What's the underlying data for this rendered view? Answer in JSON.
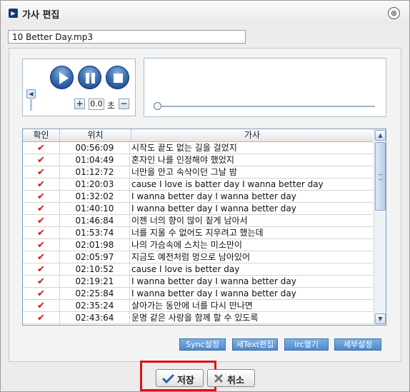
{
  "window": {
    "title": "가사 편집",
    "close_glyph": "⊗"
  },
  "file": {
    "name": "10 Better Day.mp3"
  },
  "player": {
    "offset_value": "0.0",
    "offset_unit": "초",
    "plus_glyph": "+",
    "minus_glyph": "−",
    "seek_position": 0.0
  },
  "table": {
    "headers": [
      "확인",
      "위치",
      "가사"
    ],
    "rows": [
      {
        "checked": true,
        "time": "00:56:09",
        "lyric": "시작도 끝도 없는 길을 걸었지"
      },
      {
        "checked": true,
        "time": "01:04:49",
        "lyric": "혼자인 나를 인정해야 했었지"
      },
      {
        "checked": true,
        "time": "01:12:72",
        "lyric": "너만을 안고 속삭이던 그날 밤"
      },
      {
        "checked": true,
        "time": "01:20:03",
        "lyric": "cause I love is batter day I wanna better day"
      },
      {
        "checked": true,
        "time": "01:32:02",
        "lyric": "I wanna better day I wanna better day"
      },
      {
        "checked": true,
        "time": "01:40:10",
        "lyric": "I wanna better day I wanna better day"
      },
      {
        "checked": true,
        "time": "01:46:84",
        "lyric": "이젠 너의 향이 많이 짙게 남아서"
      },
      {
        "checked": true,
        "time": "01:53:74",
        "lyric": "너를 지울 수 없어도 지우려고 했는데"
      },
      {
        "checked": true,
        "time": "02:01:98",
        "lyric": "나의 가슴속에 스치는 미소만이"
      },
      {
        "checked": true,
        "time": "02:05:97",
        "lyric": "지금도 예전처럼 멍으로 남아있어"
      },
      {
        "checked": true,
        "time": "02:10:52",
        "lyric": "cause I love is better day"
      },
      {
        "checked": true,
        "time": "02:19:21",
        "lyric": "I wanna better day I wanna better day"
      },
      {
        "checked": true,
        "time": "02:25:84",
        "lyric": "I wanna better day I wanna better day"
      },
      {
        "checked": true,
        "time": "02:35:24",
        "lyric": "살아가는 동안에 너를 다시 만나면"
      },
      {
        "checked": true,
        "time": "02:43:64",
        "lyric": "운명 같은 사랑을 함께 할 수 있도록"
      }
    ],
    "check_glyph": "✔"
  },
  "actions": {
    "sync": "Sync설정",
    "new_text": "새Text편집",
    "lrc_open": "lrc열기",
    "detail": "세부설정"
  },
  "footer": {
    "save": "저장",
    "cancel": "취소"
  },
  "colors": {
    "accent": "#3d73b8",
    "check": "#d01515",
    "highlight": "#e01010"
  }
}
